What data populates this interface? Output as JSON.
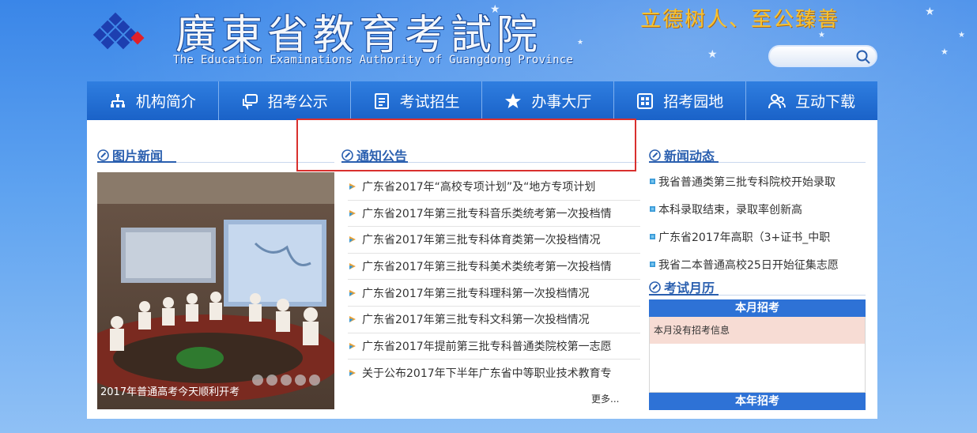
{
  "header": {
    "title_cn": "廣東省教育考試院",
    "title_en": "The Education Examinations Authority of Guangdong Province",
    "slogan": "立德树人、至公臻善",
    "search": {
      "placeholder": ""
    }
  },
  "nav": {
    "items": [
      {
        "label": "机构简介",
        "icon": "org-chart-icon"
      },
      {
        "label": "招考公示",
        "icon": "chat-bubble-icon"
      },
      {
        "label": "考试招生",
        "icon": "list-document-icon"
      },
      {
        "label": "办事大厅",
        "icon": "star-icon"
      },
      {
        "label": "招考园地",
        "icon": "grid-icon"
      },
      {
        "label": "互动下载",
        "icon": "users-icon"
      }
    ]
  },
  "sections": {
    "photo_news": {
      "title": "图片新闻",
      "caption": "2017年普通高考今天顺利开考",
      "slide_count": 5
    },
    "notices": {
      "title": "通知公告",
      "items": [
        "广东省2017年“高校专项计划”及“地方专项计划",
        "广东省2017年第三批专科音乐类统考第一次投档情",
        "广东省2017年第三批专科体育类第一次投档情况",
        "广东省2017年第三批专科美术类统考第一次投档情",
        "广东省2017年第三批专科理科第一次投档情况",
        "广东省2017年第三批专科文科第一次投档情况",
        "广东省2017年提前第三批专科普通类院校第一志愿",
        "关于公布2017年下半年广东省中等职业技术教育专"
      ],
      "more_label": "更多..."
    },
    "news": {
      "title": "新闻动态",
      "items": [
        "我省普通类第三批专科院校开始录取",
        "本科录取结束，录取率创新高",
        "广东省2017年高职（3+证书_中职",
        "我省二本普通高校25日开始征集志愿"
      ]
    },
    "calendar": {
      "title": "考试月历",
      "this_month_header": "本月招考",
      "this_month_message": "本月没有招考信息",
      "this_year_header": "本年招考"
    }
  },
  "colors": {
    "accent": "#2a5faf",
    "nav_bg": "#1a62c8",
    "highlight_box": "#d9302e",
    "slogan": "#f7c232"
  }
}
